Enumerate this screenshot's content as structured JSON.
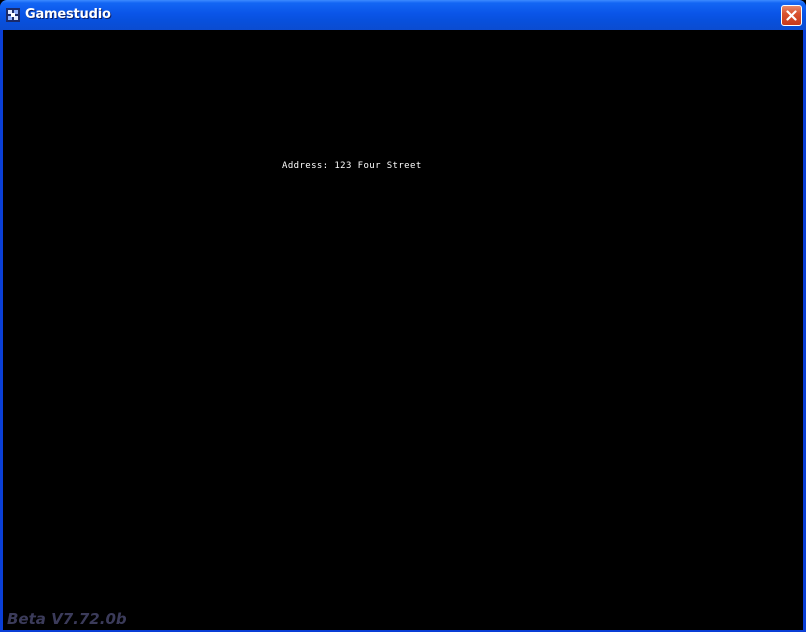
{
  "window": {
    "title": "Gamestudio",
    "icon": "gamestudio-app-icon",
    "close_icon": "close-icon"
  },
  "game": {
    "address_text": "Address: 123 Four Street",
    "version_text": "Beta V7.72.0b"
  },
  "colors": {
    "titlebar": "#0a55e8",
    "client_background": "#000000",
    "text": "#ffffff",
    "version_text": "#3b3b5a",
    "close_button": "#d9532f"
  }
}
